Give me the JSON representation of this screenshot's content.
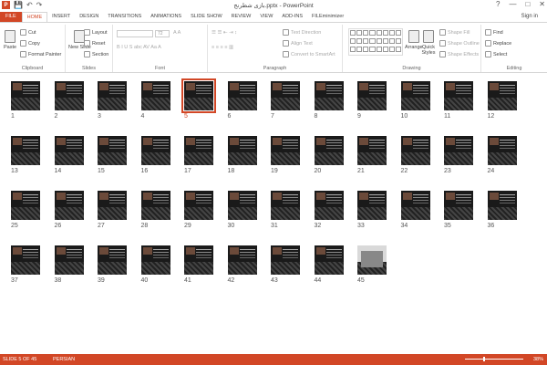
{
  "window": {
    "title": "بازی شطرنج.pptx - PowerPoint",
    "app_icon": "P",
    "controls": [
      "?",
      "—",
      "□",
      "✕"
    ]
  },
  "qat": {
    "save": "💾",
    "undo": "↶",
    "redo": "↷"
  },
  "tabs": [
    "FILE",
    "HOME",
    "INSERT",
    "DESIGN",
    "TRANSITIONS",
    "ANIMATIONS",
    "SLIDE SHOW",
    "REVIEW",
    "VIEW",
    "ADD-INS",
    "FILEminimizer"
  ],
  "active_tab": "HOME",
  "signin": "Sign in",
  "ribbon": {
    "clipboard": {
      "label": "Clipboard",
      "paste": "Paste",
      "cut": "Cut",
      "copy": "Copy",
      "format_painter": "Format Painter"
    },
    "slides": {
      "label": "Slides",
      "new_slide": "New Slide",
      "layout": "Layout",
      "reset": "Reset",
      "section": "Section"
    },
    "font": {
      "label": "Font",
      "size": "72"
    },
    "paragraph": {
      "label": "Paragraph",
      "text_direction": "Text Direction",
      "align_text": "Align Text",
      "convert": "Convert to SmartArt"
    },
    "drawing": {
      "label": "Drawing",
      "arrange": "Arrange",
      "quick_styles": "Quick Styles",
      "shape_fill": "Shape Fill",
      "shape_outline": "Shape Outline",
      "shape_effects": "Shape Effects"
    },
    "editing": {
      "label": "Editing",
      "find": "Find",
      "replace": "Replace",
      "select": "Select"
    }
  },
  "slides": {
    "count": 45,
    "selected": 5
  },
  "status": {
    "slide": "SLIDE 5 OF 45",
    "language": "PERSIAN",
    "zoom": "38%"
  },
  "colors": {
    "accent": "#d24726"
  }
}
